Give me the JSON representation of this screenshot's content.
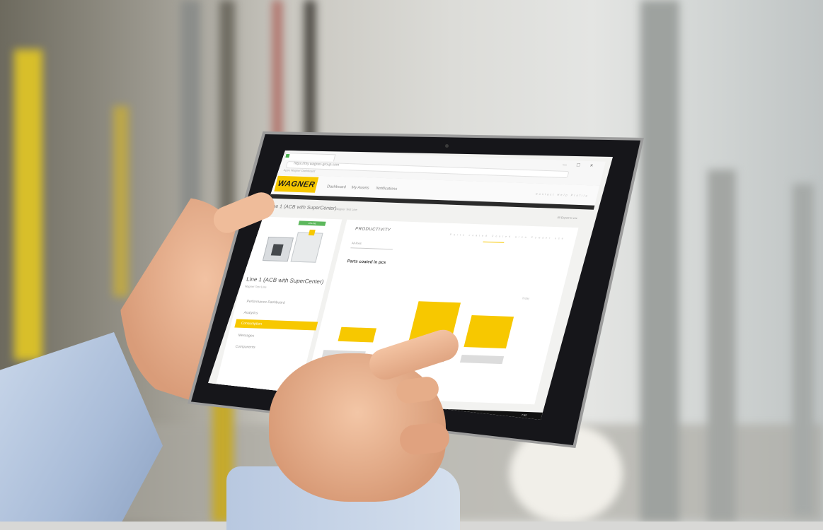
{
  "browser": {
    "url": "https://my.wagner-group.com",
    "bookmarks": "Apps   Wagner   Dashboard",
    "window_controls": "—  ☐  ✕"
  },
  "app": {
    "logo": "WAGNER",
    "nav": [
      "Dashboard",
      "My Assets",
      "Notifications"
    ],
    "user_links": "Contact  Help  Profile"
  },
  "breadcrumb": {
    "title": "Line 1 (ACB with SuperCenter)",
    "subtitle": "Wagner Test Line",
    "right_control": "All   Export to csv"
  },
  "left_panel": {
    "status_badge": "ONLINE",
    "line_title": "Line 1 (ACB with SuperCenter)",
    "line_subtitle": "Wagner Test Line",
    "menu": [
      "Performance Dashboard",
      "Analytics",
      "Consumption",
      "Messages",
      "Components"
    ],
    "active_menu_index": 2
  },
  "main_panel": {
    "section_title": "PRODUCTIVITY",
    "select_value": "All lines",
    "tabs": "Parts coated   Coated area   Powder use",
    "chart_title": "Parts coated in pcs",
    "legend": "Today"
  },
  "chart_data": {
    "type": "bar",
    "categories": [
      "",
      "",
      ""
    ],
    "values": [
      20,
      60,
      45
    ],
    "title": "Parts coated in pcs",
    "color": "#f7c800"
  },
  "taskbar": {
    "clock_time": "7:52",
    "clock_date": "9/6/2018"
  },
  "colors": {
    "accent": "#f7c800",
    "dark_bar": "#2a2a2a",
    "status_green": "#5cb85c"
  }
}
